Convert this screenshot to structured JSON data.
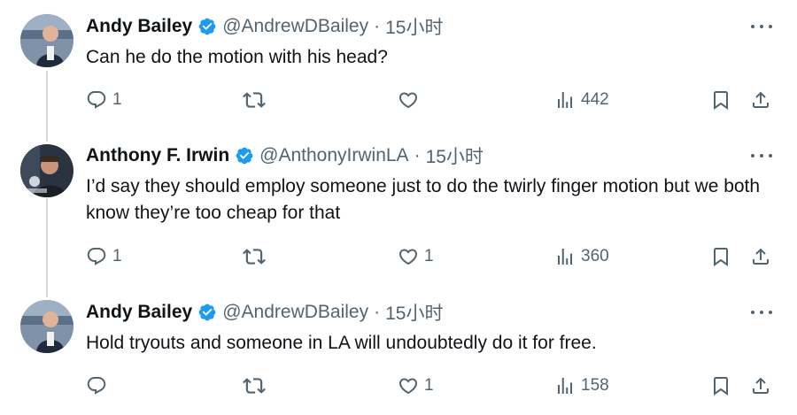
{
  "tweets": [
    {
      "name": "Andy Bailey",
      "handle": "@AndrewDBailey",
      "dot": "·",
      "time": "15小时",
      "text": "Can he do the motion with his head?",
      "replies": "1",
      "retweets": "",
      "likes": "",
      "views": "442"
    },
    {
      "name": "Anthony F. Irwin",
      "handle": "@AnthonyIrwinLA",
      "dot": "·",
      "time": "15小时",
      "text": "I’d say they should employ someone just to do the twirly finger motion but we both know they’re too cheap for that",
      "replies": "1",
      "retweets": "",
      "likes": "1",
      "views": "360"
    },
    {
      "name": "Andy Bailey",
      "handle": "@AndrewDBailey",
      "dot": "·",
      "time": "15小时",
      "text": "Hold tryouts and someone in LA will undoubtedly do it for free.",
      "replies": "",
      "retweets": "",
      "likes": "1",
      "views": "158"
    }
  ],
  "colors": {
    "text": "#0f1419",
    "secondary": "#536471",
    "verified": "#1d9bf0",
    "thread_line": "#cfd9de"
  },
  "icons": [
    "reply-icon",
    "retweet-icon",
    "like-icon",
    "views-icon",
    "bookmark-icon",
    "share-icon",
    "more-icon",
    "verified-icon"
  ]
}
